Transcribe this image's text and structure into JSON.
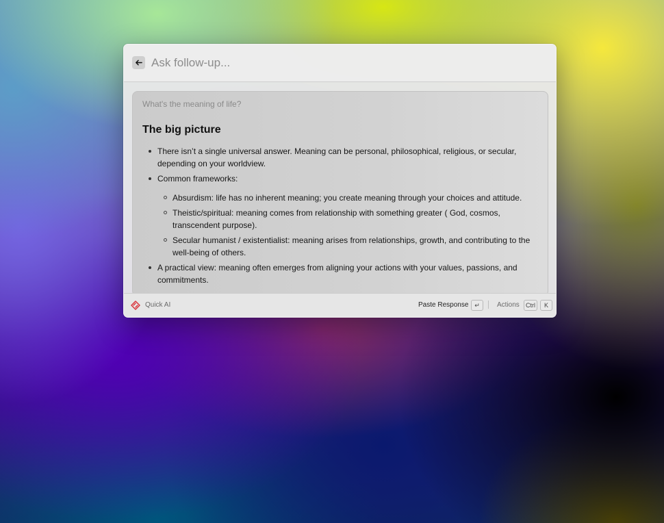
{
  "header": {
    "back_icon": "arrow-left-icon",
    "input_placeholder": "Ask follow-up...",
    "input_value": ""
  },
  "response": {
    "question": "What's the meaning of life?",
    "heading": "The big picture",
    "bullets": [
      {
        "text": "There isn’t a single universal answer. Meaning can be personal, philosophical, religious, or secular, depending on your worldview."
      },
      {
        "text": "Common frameworks:"
      },
      {
        "text": "A practical view: meaning often emerges from aligning your actions with your values, passions, and commitments."
      }
    ],
    "frameworks": [
      "Absurdism: life has no inherent meaning; you create meaning through your choices and attitude.",
      "Theistic/spiritual: meaning comes from relationship with something greater ( God, cosmos, transcendent purpose).",
      "Secular humanist / existentialist: meaning arises from relationships, growth, and contributing to the well-being of others."
    ]
  },
  "footer": {
    "app_icon": "raycast-ai-icon",
    "app_name": "Quick AI",
    "paste_label": "Paste Response",
    "paste_key": "↵",
    "actions_label": "Actions",
    "actions_key_1": "Ctrl",
    "actions_key_2": "K"
  },
  "colors": {
    "app_icon_red": "#d9363e",
    "window_bg": "#e8e8e8",
    "card_bg": "#cfcfcf"
  }
}
